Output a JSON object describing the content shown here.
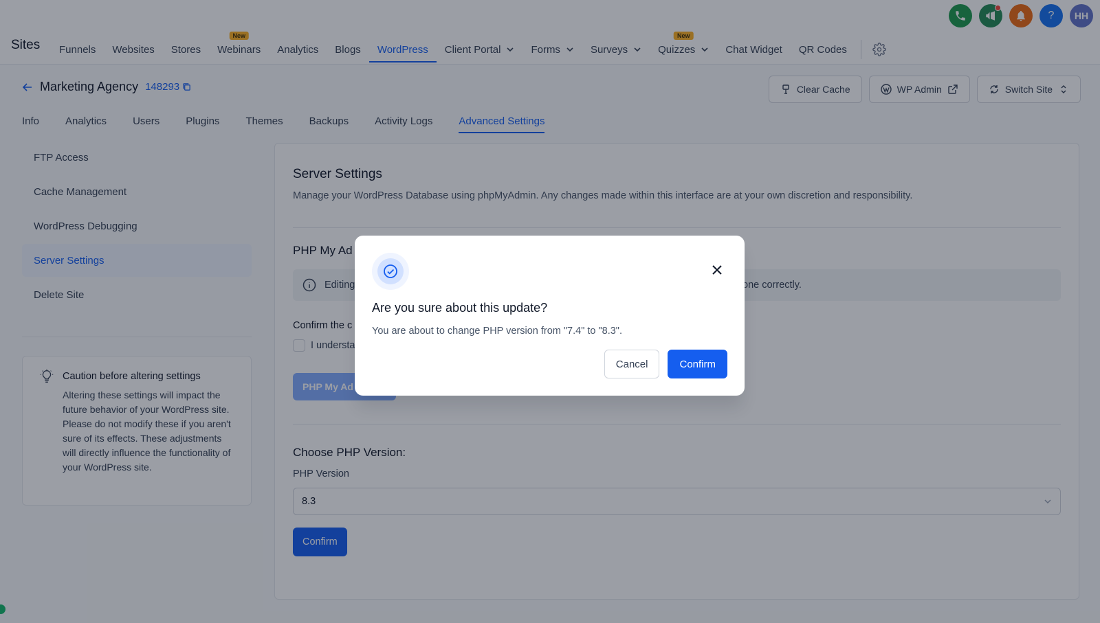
{
  "header": {
    "brand": "Sites",
    "nav": [
      {
        "label": "Funnels"
      },
      {
        "label": "Websites"
      },
      {
        "label": "Stores"
      },
      {
        "label": "Webinars",
        "badge": "New"
      },
      {
        "label": "Analytics"
      },
      {
        "label": "Blogs"
      },
      {
        "label": "WordPress",
        "active": true
      },
      {
        "label": "Client Portal",
        "dropdown": true
      },
      {
        "label": "Forms",
        "dropdown": true
      },
      {
        "label": "Surveys",
        "dropdown": true
      },
      {
        "label": "Quizzes",
        "badge": "New",
        "dropdown": true
      },
      {
        "label": "Chat Widget"
      },
      {
        "label": "QR Codes"
      }
    ],
    "utility": [
      {
        "icon": "phone-icon",
        "color": "#1c9a4d"
      },
      {
        "icon": "megaphone-icon",
        "color": "#248a55",
        "dot": true
      },
      {
        "icon": "bell-icon",
        "color": "#ec6a12"
      },
      {
        "icon": "help-icon",
        "color": "#1570ef",
        "glyph": "?"
      },
      {
        "icon": "avatar",
        "color": "#6172c8",
        "glyph": "HH"
      }
    ]
  },
  "site": {
    "name": "Marketing Agency",
    "id": "148293",
    "actions": {
      "clear_cache": "Clear Cache",
      "wp_admin": "WP Admin",
      "switch_site": "Switch Site"
    }
  },
  "subtabs": [
    {
      "label": "Info"
    },
    {
      "label": "Analytics"
    },
    {
      "label": "Users"
    },
    {
      "label": "Plugins"
    },
    {
      "label": "Themes"
    },
    {
      "label": "Backups"
    },
    {
      "label": "Activity Logs"
    },
    {
      "label": "Advanced Settings",
      "active": true
    }
  ],
  "side_menu": [
    {
      "label": "FTP Access"
    },
    {
      "label": "Cache Management"
    },
    {
      "label": "WordPress Debugging"
    },
    {
      "label": "Server Settings",
      "active": true
    },
    {
      "label": "Delete Site"
    }
  ],
  "caution": {
    "title": "Caution before altering settings",
    "text": "Altering these settings will impact the future behavior of your WordPress site. Please do not modify these if you aren't sure of its effects. These adjustments will directly influence the functionality of your WordPress site."
  },
  "panel": {
    "title": "Server Settings",
    "description": "Manage your WordPress Database using phpMyAdmin. Any changes made within this interface are at your own discretion and responsibility.",
    "pma_title": "PHP My Ad",
    "info_left": "Editing",
    "info_right": "one correctly.",
    "confirm_label": "Confirm the c",
    "checkbox_label": "I understa",
    "pma_button": "PHP My Ad",
    "php_section_title": "Choose PHP Version:",
    "php_label": "PHP Version",
    "php_value": "8.3",
    "php_confirm": "Confirm"
  },
  "modal": {
    "title": "Are you sure about this update?",
    "text": "You are about to change PHP version from \"7.4\" to \"8.3\".",
    "cancel": "Cancel",
    "confirm": "Confirm"
  },
  "colors": {
    "accent": "#155eef",
    "overlay": "rgba(16,24,40,0.42)"
  }
}
